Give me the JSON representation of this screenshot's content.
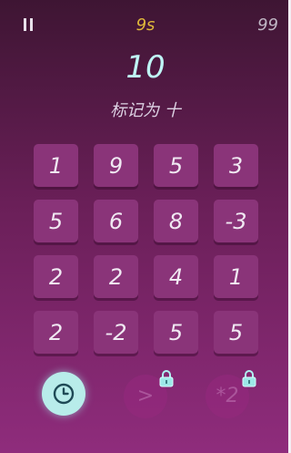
{
  "top_bar": {
    "timer": "9s",
    "coins": "99",
    "pause_icon": "pause-icon"
  },
  "puzzle": {
    "target": "10",
    "instruction": "标记为 十"
  },
  "grid": {
    "rows": [
      [
        "1",
        "9",
        "5",
        "3"
      ],
      [
        "5",
        "6",
        "8",
        "-3"
      ],
      [
        "2",
        "2",
        "4",
        "1"
      ],
      [
        "2",
        "-2",
        "5",
        "5"
      ]
    ]
  },
  "powerups": {
    "hint": {
      "icon": "clock-icon",
      "locked": false
    },
    "skip": {
      "glyph": ">",
      "icon": "lock-icon",
      "locked": true
    },
    "double": {
      "glyph": "*2",
      "icon": "lock-icon",
      "locked": true
    }
  },
  "colors": {
    "background_top": "#3e1533",
    "background_bottom": "#8f2c7c",
    "tile": "#8a3479",
    "timer": "#e0b93a",
    "target": "#bff5f5",
    "accent_cyan": "#b8ecea"
  }
}
